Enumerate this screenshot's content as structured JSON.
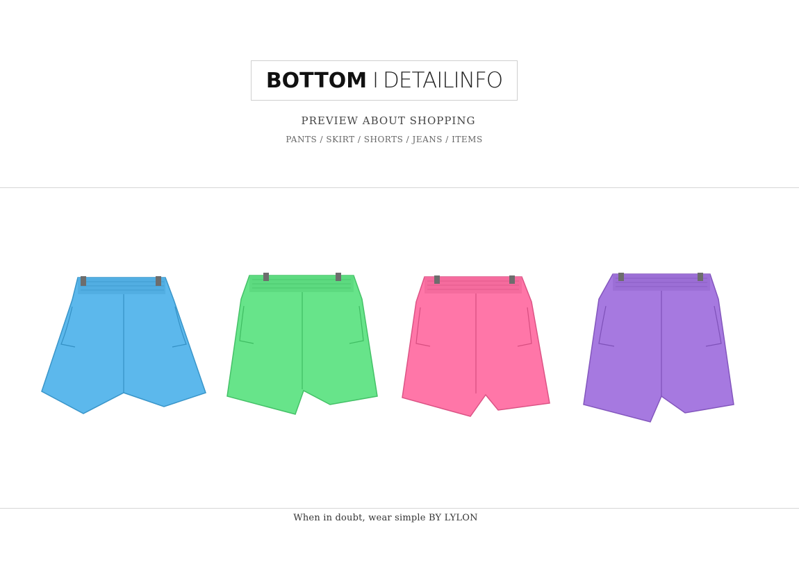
{
  "header": {
    "logo_bold": "BOTTOM",
    "logo_separator": "I",
    "logo_light": "DETAILINFO",
    "subtitle": "PREVIEW ABOUT SHOPPING",
    "categories": "PANTS / SKIRT / SHORTS / JEANS / ITEMS"
  },
  "products": [
    {
      "name": "blue shorts",
      "color": "#5cb8ec"
    },
    {
      "name": "green shorts",
      "color": "#67e48a"
    },
    {
      "name": "pink shorts",
      "color": "#ff76a8"
    },
    {
      "name": "purple shorts",
      "color": "#a679e0"
    }
  ],
  "footer": {
    "tagline": "When in doubt, wear simple BY LYLON"
  }
}
